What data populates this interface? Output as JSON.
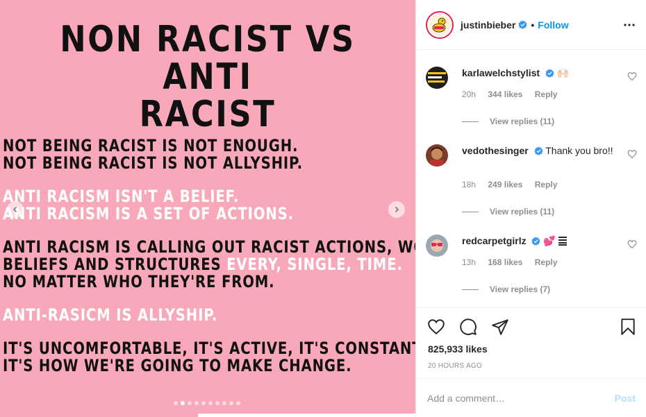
{
  "post": {
    "image_title_line1": "NON RACIST VS ANTI",
    "image_title_line2": "RACIST",
    "paragraphs": [
      {
        "lines": [
          {
            "text": "NOT BEING RACIST IS NOT ENOUGH.",
            "color": "#111111"
          },
          {
            "text": "NOT BEING RACIST IS NOT ALLYSHIP.",
            "color": "#111111"
          }
        ]
      },
      {
        "lines": [
          {
            "text": "ANTI RACISM ISN'T A BELIEF.",
            "color": "#ffffff"
          },
          {
            "text": "ANTI RACISM IS A SET OF ACTIONS.",
            "color": "#ffffff"
          }
        ]
      }
    ],
    "para3_line1": "ANTI RACISM IS CALLING OUT RACIST ACTIONS, WORDS,",
    "para3_line2_dark": "BELIEFS AND STRUCTURES ",
    "para3_line2_white": "EVERY, SINGLE, TIME.",
    "para3_line3": "NO MATTER WHO THEY'RE FROM.",
    "para4_line1": "ANTI-RASICM IS ALLYSHIP.",
    "para5_line1": "IT'S UNCOMFORTABLE, IT'S ACTIVE, IT'S CONSTANT, AND",
    "para5_line2": "IT'S HOW WE'RE GOING TO MAKE CHANGE.",
    "carousel_dot_count": 10,
    "carousel_active_index": 1,
    "background_color": "#f8a8b8"
  },
  "header": {
    "username": "justinbieber",
    "separator": "•",
    "follow_label": "Follow",
    "verified_icon": "verified-badge-icon",
    "more_icon": "more-options-icon"
  },
  "comments": [
    {
      "user": "karlawelchstylist",
      "text": "🙌🏻",
      "time": "20h",
      "likes": "344 likes",
      "reply": "Reply",
      "view_replies": "View replies (11)"
    },
    {
      "user": "vedothesinger",
      "text": "Thank you bro!!",
      "time": "18h",
      "likes": "249 likes",
      "reply": "Reply",
      "view_replies": "View replies (11)"
    },
    {
      "user": "redcarpetgirlz",
      "text": "💕",
      "time": "13h",
      "likes": "168 likes",
      "reply": "Reply",
      "view_replies": "View replies (7)"
    }
  ],
  "actions": {
    "likes_count": "825,933 likes",
    "time_ago": "20 HOURS AGO"
  },
  "add_comment": {
    "placeholder": "Add a comment…",
    "post_label": "Post"
  },
  "colors": {
    "accent": "#0095f6",
    "post_disabled": "#b2dffc",
    "muted": "#8e8e8e"
  }
}
